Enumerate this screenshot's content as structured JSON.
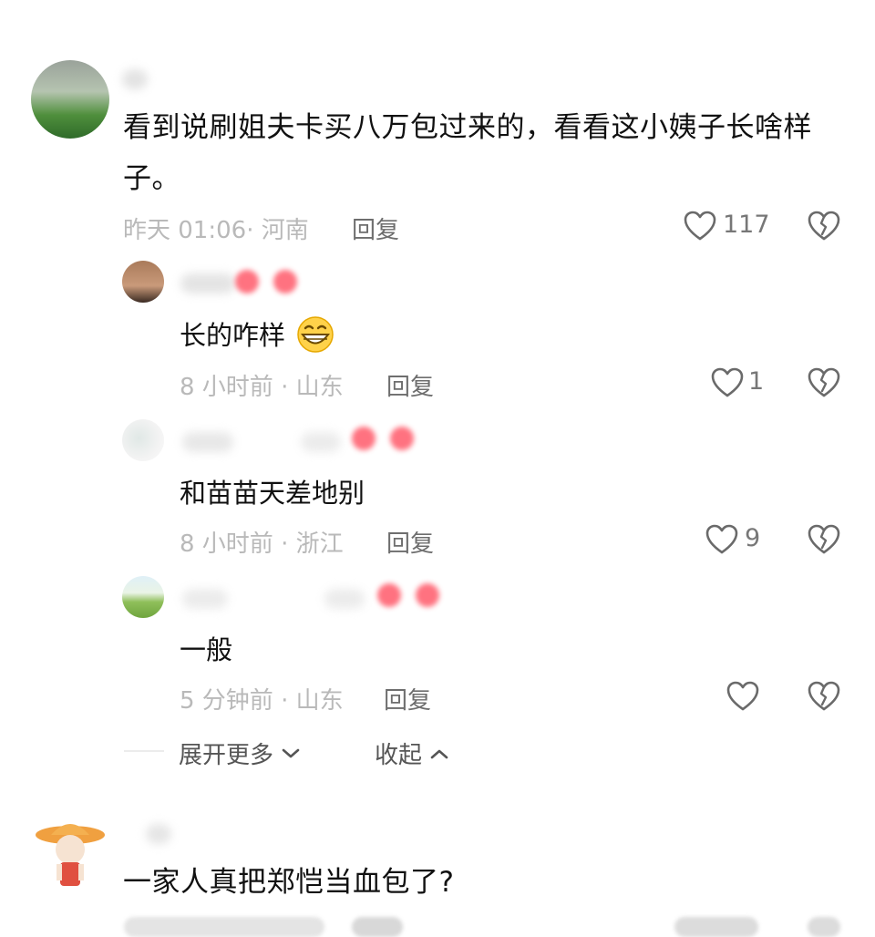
{
  "comments": [
    {
      "text_line1": "看到说刷姐夫卡买八万包过来的，看看这小姨子长啥样",
      "text_line2": "子。",
      "meta": "昨天 01:06· 河南",
      "reply_label": "回复",
      "likes": "117",
      "replies": [
        {
          "text": "长的咋样",
          "emoji": "grinning-emoji",
          "meta": "8 小时前 · 山东",
          "reply_label": "回复",
          "likes": "1"
        },
        {
          "text": "和苗苗天差地别",
          "meta": "8 小时前 · 浙江",
          "reply_label": "回复",
          "likes": "9"
        },
        {
          "text": "一般",
          "meta": "5 分钟前 · 山东",
          "reply_label": "回复",
          "likes": ""
        }
      ],
      "expand_label": "展开更多",
      "collapse_label": "收起"
    },
    {
      "text_line1": "一家人真把郑恺当血包了?"
    }
  ],
  "colors": {
    "meta_gray": "#b9b9b9",
    "reply_gray": "#6e6e6e",
    "badge_red": "#ff5a6a"
  }
}
